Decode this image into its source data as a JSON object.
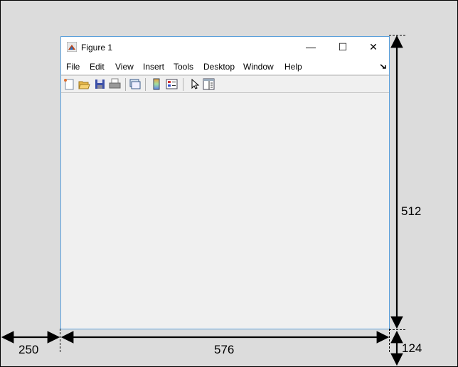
{
  "window": {
    "title": "Figure 1",
    "controls": {
      "minimize": "—",
      "maximize": "☐",
      "close": "✕"
    },
    "menu": [
      "File",
      "Edit",
      "View",
      "Insert",
      "Tools",
      "Desktop",
      "Window",
      "Help"
    ],
    "toolbar": [
      "new-figure",
      "open-file",
      "save",
      "print",
      "link-plot",
      "insert-colorbar",
      "insert-legend",
      "edit-plot",
      "property-inspector"
    ]
  },
  "dimensions": {
    "left": "250",
    "width": "576",
    "height": "512",
    "bottom": "124"
  }
}
